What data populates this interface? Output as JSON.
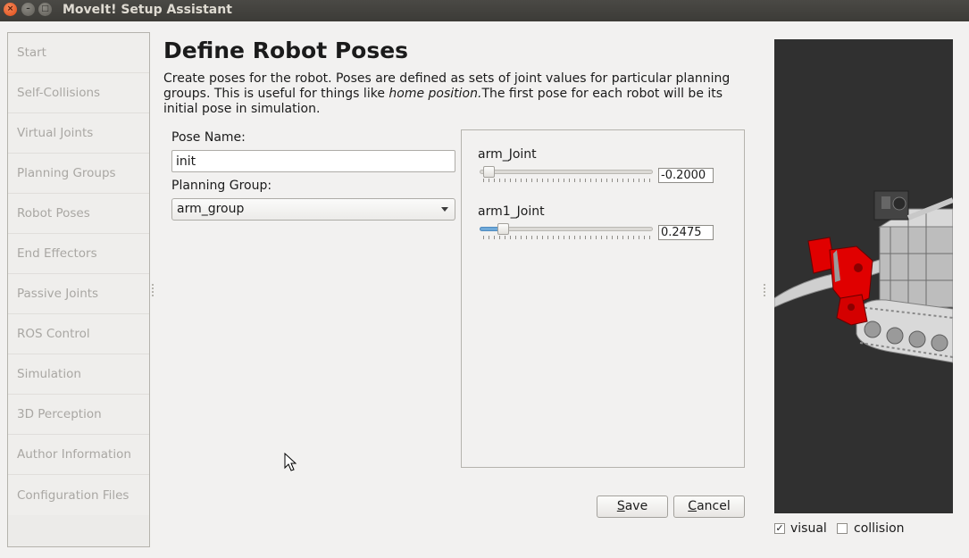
{
  "window": {
    "title": "MoveIt! Setup Assistant"
  },
  "sidebar": {
    "items": [
      {
        "label": "Start"
      },
      {
        "label": "Self-Collisions"
      },
      {
        "label": "Virtual Joints"
      },
      {
        "label": "Planning Groups"
      },
      {
        "label": "Robot Poses"
      },
      {
        "label": "End Effectors"
      },
      {
        "label": "Passive Joints"
      },
      {
        "label": "ROS Control"
      },
      {
        "label": "Simulation"
      },
      {
        "label": "3D Perception"
      },
      {
        "label": "Author Information"
      },
      {
        "label": "Configuration Files"
      }
    ]
  },
  "main": {
    "title": "Define Robot Poses",
    "description_pre": "Create poses for the robot. Poses are defined as sets of joint values for particular planning groups. This is useful for things like ",
    "description_em": "home position.",
    "description_post": "The first pose for each robot will be its initial pose in simulation.",
    "pose_name_label": "Pose Name:",
    "pose_name_value": "init",
    "planning_group_label": "Planning Group:",
    "planning_group_value": "arm_group"
  },
  "joints": [
    {
      "name": "arm_Joint",
      "value": "-0.2000",
      "slider_fraction": 0.02
    },
    {
      "name": "arm1_Joint",
      "value": "0.2475",
      "slider_fraction": 0.11
    }
  ],
  "buttons": {
    "save_first": "S",
    "save_rest": "ave",
    "cancel_first": "C",
    "cancel_rest": "ancel"
  },
  "view_options": {
    "visual_label": "visual",
    "visual_checked": "✓",
    "collision_label": "collision"
  },
  "colors": {
    "viewport_bg": "#303030",
    "robot_highlight": "#e00000",
    "slider_fill": "#6fa9d8"
  }
}
